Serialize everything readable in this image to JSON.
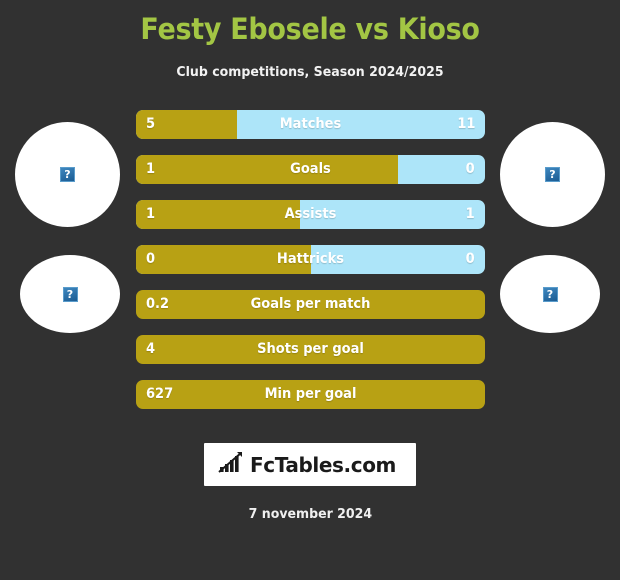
{
  "header": {
    "title": "Festy Ebosele vs Kioso",
    "subtitle": "Club competitions, Season 2024/2025",
    "title_color": "#a3c644"
  },
  "colors": {
    "background": "#313131",
    "left_player": "#b8a114",
    "right_player": "#ade5f9",
    "title_accent": "#a3c644"
  },
  "avatars": {
    "left_top": {
      "placeholder": "?"
    },
    "left_bottom": {
      "placeholder": "?"
    },
    "right_top": {
      "placeholder": "?"
    },
    "right_bottom": {
      "placeholder": "?"
    }
  },
  "chart_data": {
    "type": "bar",
    "title": "Festy Ebosele vs Kioso",
    "subtitle": "Club competitions, Season 2024/2025",
    "orientation": "horizontal-diverging",
    "categories": [
      "Matches",
      "Goals",
      "Assists",
      "Hattricks",
      "Goals per match",
      "Shots per goal",
      "Min per goal"
    ],
    "series": [
      {
        "name": "Festy Ebosele",
        "side": "left",
        "color": "#b8a114",
        "values": [
          5,
          1,
          1,
          0,
          0.2,
          4,
          627
        ]
      },
      {
        "name": "Kioso",
        "side": "right",
        "color": "#ade5f9",
        "values": [
          11,
          0,
          1,
          0,
          null,
          null,
          null
        ]
      }
    ],
    "legend": "none",
    "grid": false
  },
  "rows": [
    {
      "label": "Matches",
      "left_value": "5",
      "right_value": "11",
      "fill_percent": 29,
      "full": false
    },
    {
      "label": "Goals",
      "left_value": "1",
      "right_value": "0",
      "fill_percent": 75,
      "full": false
    },
    {
      "label": "Assists",
      "left_value": "1",
      "right_value": "1",
      "fill_percent": 47,
      "full": false
    },
    {
      "label": "Hattricks",
      "left_value": "0",
      "right_value": "0",
      "fill_percent": 50,
      "full": false
    },
    {
      "label": "Goals per match",
      "left_value": "0.2",
      "right_value": "",
      "fill_percent": 100,
      "full": true
    },
    {
      "label": "Shots per goal",
      "left_value": "4",
      "right_value": "",
      "fill_percent": 100,
      "full": true
    },
    {
      "label": "Min per goal",
      "left_value": "627",
      "right_value": "",
      "fill_percent": 100,
      "full": true
    }
  ],
  "footer": {
    "logo_text": "FcTables.com",
    "logo_icon": "bar-chart-trend-icon",
    "date": "7 november 2024"
  }
}
